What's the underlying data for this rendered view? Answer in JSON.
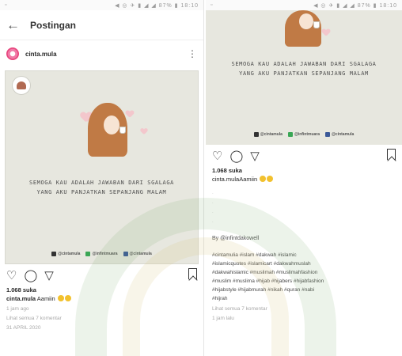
{
  "left": {
    "status": {
      "left": "▫",
      "right": "◀ ◎ ✈ ▮ ◢ ◢ 87% ▮ 18:10"
    },
    "appbar": {
      "title": "Postingan"
    },
    "post": {
      "username": "cinta.mula",
      "quote_lines": [
        "SEMOGA KAU ADALAH JAWABAN DARI SGALAGA",
        "YANG AKU PANJATKAN SEPANJANG MALAM"
      ],
      "socials": [
        "@cintamula",
        "@infintmuara",
        "@cintamula"
      ],
      "likes": "1.068 suka",
      "caption_user": "cinta.mula",
      "caption_text": "Aamiin",
      "time": "1 jam ago",
      "comments": "Lihat semua 7 komentar",
      "date": "31 APRIL 2020"
    }
  },
  "right": {
    "status": {
      "left": "▫",
      "right": "◀ ◎ ✈ ▮ ◢ ◢ 87% ▮ 18:10"
    },
    "post": {
      "quote_lines": [
        "SEMOGA KAU ADALAH JAWABAN DARI SGALAGA",
        "YANG AKU PANJATKAN SEPANJANG MALAM"
      ],
      "socials": [
        "@cintamula",
        "@infintmuara",
        "@cintamula"
      ],
      "likes": "1.068 suka",
      "caption_user": "cinta.mula",
      "caption_text": "Aamiin",
      "credit": "By @infintdakowell",
      "hashtags": [
        "#cintamulia #islam #dakwah #islamic",
        "#islamicquotes #islamicart #dakwahmuslah",
        "#dakwahislamic #muslimah #muslimahfashion",
        "#muslim #muslima #hijab #hijabers #hijabfashion",
        "#hijabstyle #hijabmurah #nikah #quran #nabi",
        "#hijrah"
      ],
      "comments": "Lihat semua 7 komentar",
      "time": "1 jam lalu"
    }
  },
  "colors": {
    "hood": "#c07a45",
    "pink": "#f3c7cc",
    "avatar_ring": "#e8467e",
    "photo_bg": "#e7e7df"
  }
}
